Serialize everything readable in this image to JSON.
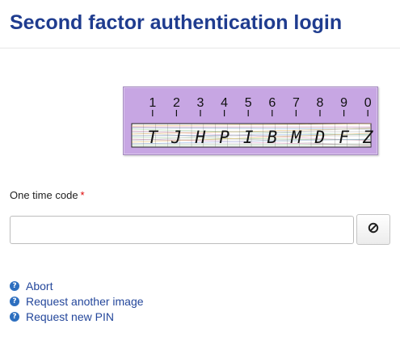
{
  "header": {
    "title": "Second factor authentication login"
  },
  "grid_card": {
    "background_color": "#c7a6e3",
    "digits": [
      "1",
      "2",
      "3",
      "4",
      "5",
      "6",
      "7",
      "8",
      "9",
      "0"
    ],
    "letters": [
      "T",
      "J",
      "H",
      "P",
      "I",
      "B",
      "M",
      "D",
      "F",
      "Z"
    ]
  },
  "otp": {
    "label": "One time code",
    "required_marker": "*",
    "value": "",
    "placeholder": ""
  },
  "clear_button": {
    "icon": "ban-icon"
  },
  "links": [
    {
      "label": "Abort",
      "icon": "help-circle-icon"
    },
    {
      "label": "Request another image",
      "icon": "help-circle-icon"
    },
    {
      "label": "Request new PIN",
      "icon": "help-circle-icon"
    }
  ],
  "colors": {
    "title": "#1f3c8f",
    "link": "#24479b",
    "required": "#dd0000"
  }
}
